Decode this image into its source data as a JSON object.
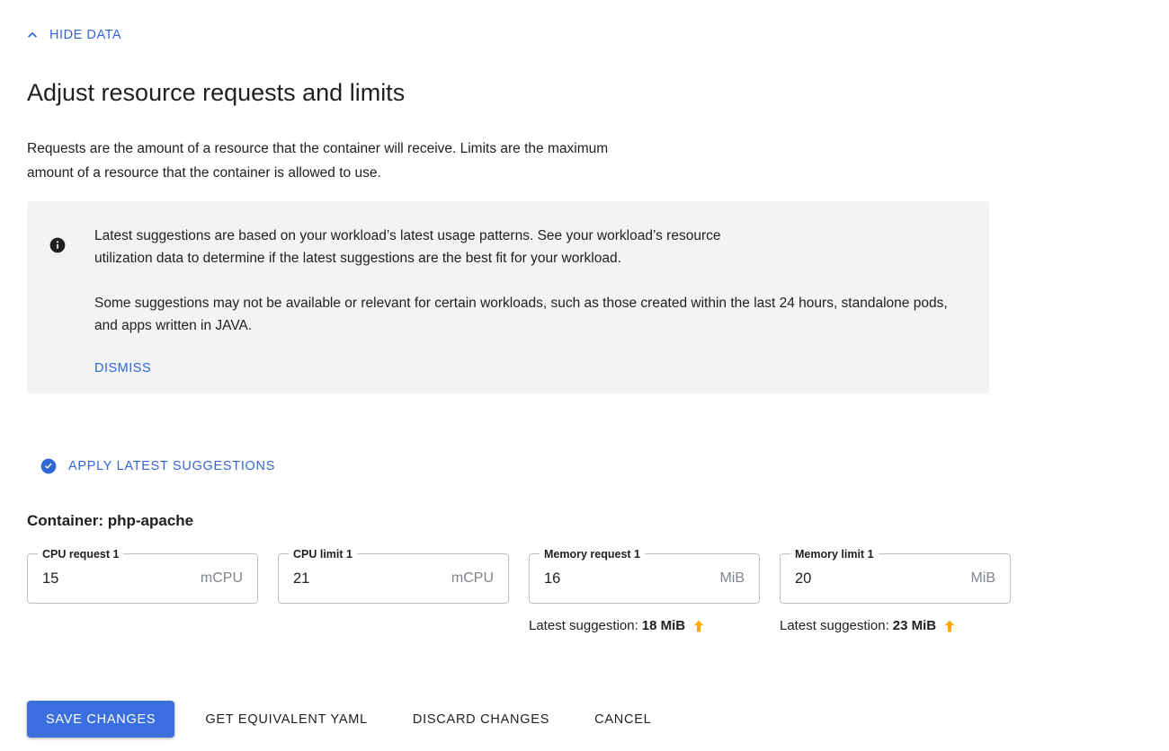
{
  "toggle": {
    "label": "HIDE DATA",
    "icon": "chevron-up-icon",
    "color": "#3367d6"
  },
  "page": {
    "title": "Adjust resource requests and limits",
    "description": "Requests are the amount of a resource that the container will receive. Limits are the maximum amount of a resource that the container is allowed to use."
  },
  "info_panel": {
    "icon": "info-icon",
    "background": "#f1f3f4",
    "paragraph_1": "Latest suggestions are based on your workload’s latest usage patterns. See your workload’s resource utilization data to determine if the latest suggestions are the best fit for your workload.",
    "paragraph_2": "Some suggestions may not be available or relevant for certain workloads, such as those created within the last 24 hours, standalone pods, and apps written in JAVA.",
    "dismiss_label": "DISMISS"
  },
  "apply_suggestions": {
    "icon": "check-circle-icon",
    "label": "APPLY LATEST SUGGESTIONS",
    "color": "#3367d6"
  },
  "container": {
    "heading": "Container: php-apache"
  },
  "fields": [
    {
      "label": "CPU request 1",
      "value": "15",
      "placeholder": "",
      "unit": "mCPU",
      "suggestion": null
    },
    {
      "label": "CPU limit 1",
      "value": "21",
      "placeholder": "",
      "unit": "mCPU",
      "suggestion": null
    },
    {
      "label": "Memory request 1",
      "value": "16",
      "placeholder": "",
      "unit": "MiB",
      "suggestion": {
        "label": "Latest suggestion:",
        "value": "18 MiB",
        "trend": "up",
        "trend_icon": "arrow-up-icon",
        "trend_color": "#f9ab00"
      }
    },
    {
      "label": "Memory limit 1",
      "value": "20",
      "placeholder": "",
      "unit": "MiB",
      "suggestion": {
        "label": "Latest suggestion:",
        "value": "23 MiB",
        "trend": "up",
        "trend_icon": "arrow-up-icon",
        "trend_color": "#f9ab00"
      }
    }
  ],
  "actions": {
    "save_label": "SAVE CHANGES",
    "yaml_label": "GET EQUIVALENT YAML",
    "discard_label": "DISCARD CHANGES",
    "cancel_label": "CANCEL",
    "primary_color": "#3b6fe0"
  }
}
